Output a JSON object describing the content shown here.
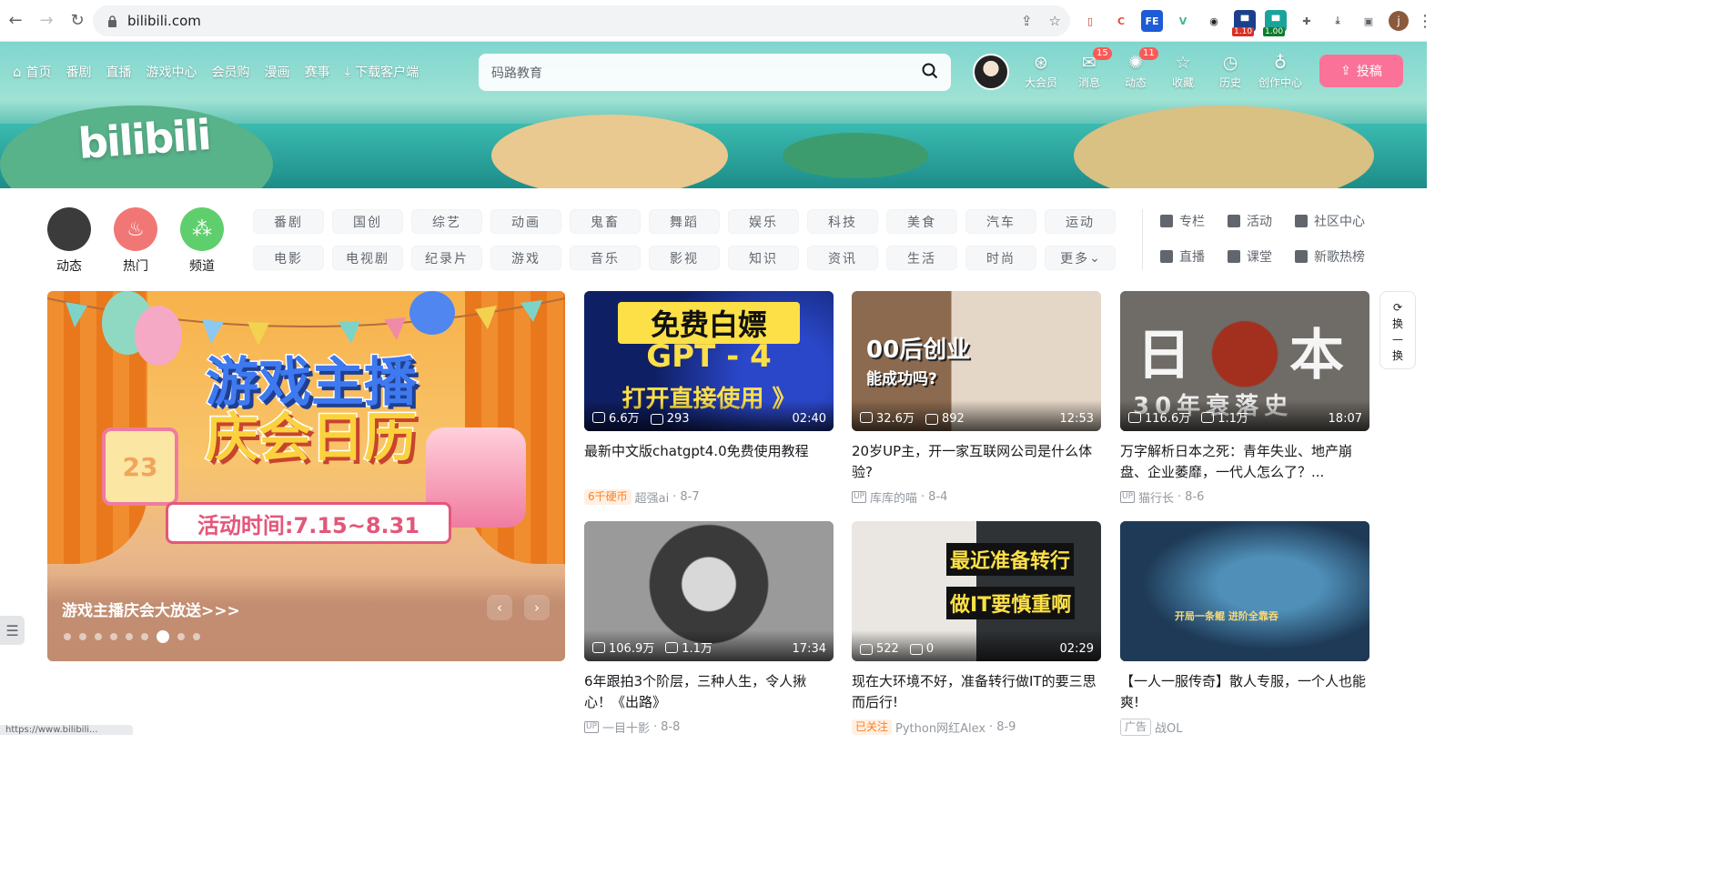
{
  "browser": {
    "url": "bilibili.com",
    "extensions": [
      {
        "name": "ext-book-icon",
        "bg": "#ffffff",
        "fg": "#c0392b",
        "glyph": "▯",
        "badge": ""
      },
      {
        "name": "ext-c-icon",
        "bg": "#ffffff",
        "fg": "#e84c3d",
        "glyph": "C",
        "badge": ""
      },
      {
        "name": "ext-fe-icon",
        "bg": "#1e5bd6",
        "fg": "#ffffff",
        "glyph": "FE",
        "badge": ""
      },
      {
        "name": "ext-vue-icon",
        "bg": "#ffffff",
        "fg": "#41b883",
        "glyph": "V",
        "badge": ""
      },
      {
        "name": "ext-mask-icon",
        "bg": "#ffffff",
        "fg": "#222222",
        "glyph": "◉",
        "badge": ""
      },
      {
        "name": "ext-red-icon",
        "bg": "#1c3f8c",
        "fg": "#ffffff",
        "glyph": "▀",
        "badge": "1.10",
        "badge_bg": "#d93025"
      },
      {
        "name": "ext-green-icon",
        "bg": "#1aa39a",
        "fg": "#ffffff",
        "glyph": "▀",
        "badge": "1.00",
        "badge_bg": "#0f7b2c"
      },
      {
        "name": "ext-puzzle-icon",
        "bg": "#ffffff",
        "fg": "#5f6368",
        "glyph": "✚",
        "badge": ""
      },
      {
        "name": "download-icon",
        "bg": "#ffffff",
        "fg": "#5f6368",
        "glyph": "⤓",
        "badge": ""
      },
      {
        "name": "sidebar-icon",
        "bg": "#ffffff",
        "fg": "#5f6368",
        "glyph": "▣",
        "badge": ""
      }
    ],
    "profile_initial": "j",
    "status_url": "https://www.bilibili..."
  },
  "header": {
    "nav": [
      {
        "name": "nav-home",
        "label": "首页",
        "icon": true
      },
      {
        "name": "nav-bangumi",
        "label": "番剧"
      },
      {
        "name": "nav-live",
        "label": "直播"
      },
      {
        "name": "nav-game-center",
        "label": "游戏中心"
      },
      {
        "name": "nav-vip-shop",
        "label": "会员购"
      },
      {
        "name": "nav-manga",
        "label": "漫画"
      },
      {
        "name": "nav-match",
        "label": "赛事"
      },
      {
        "name": "nav-download-client",
        "label": "下载客户端",
        "icon": true
      }
    ],
    "search_placeholder": "码路教育",
    "logo": "bilibili",
    "right": [
      {
        "name": "vip-entry",
        "label": "大会员",
        "glyph": "⊛",
        "badge": ""
      },
      {
        "name": "message-entry",
        "label": "消息",
        "glyph": "✉",
        "badge": "15"
      },
      {
        "name": "dynamic-entry",
        "label": "动态",
        "glyph": "✺",
        "badge": "11"
      },
      {
        "name": "favorites-entry",
        "label": "收藏",
        "glyph": "☆",
        "badge": ""
      },
      {
        "name": "history-entry",
        "label": "历史",
        "glyph": "◷",
        "badge": ""
      },
      {
        "name": "creator-center-entry",
        "label": "创作中心",
        "glyph": "♁",
        "badge": ""
      }
    ],
    "upload_label": "投稿"
  },
  "channels": {
    "icons": [
      {
        "name": "channel-dynamic",
        "label": "动态",
        "color": "#3b3b3b"
      },
      {
        "name": "channel-hot",
        "label": "热门",
        "color": "#f07775"
      },
      {
        "name": "channel-channels",
        "label": "频道",
        "color": "#5ecf6c"
      }
    ],
    "tags": [
      "番剧",
      "国创",
      "综艺",
      "动画",
      "鬼畜",
      "舞蹈",
      "娱乐",
      "科技",
      "美食",
      "汽车",
      "运动",
      "电影",
      "电视剧",
      "纪录片",
      "游戏",
      "音乐",
      "影视",
      "知识",
      "资讯",
      "生活",
      "时尚",
      "更多"
    ],
    "extra": [
      {
        "name": "column-link",
        "label": "专栏"
      },
      {
        "name": "activity-link",
        "label": "活动"
      },
      {
        "name": "community-link",
        "label": "社区中心"
      },
      {
        "name": "live-link",
        "label": "直播"
      },
      {
        "name": "classroom-link",
        "label": "课堂"
      },
      {
        "name": "new-songs-link",
        "label": "新歌热榜"
      }
    ]
  },
  "carousel": {
    "headline_line1": "游戏主播",
    "headline_line2": "庆会日历",
    "date_text": "活动时间:7.15~8.31",
    "calendar_day": "23",
    "caption": "游戏主播庆会大放送>>>",
    "dot_count": 9,
    "active_dot": 6
  },
  "videos": [
    {
      "title": "最新中文版chatgpt4.0免费使用教程",
      "views": "6.6万",
      "danmaku": "293",
      "duration": "02:40",
      "tag": "6千硬币",
      "tag_style": "orange",
      "author": "超强ai",
      "date": "8-7",
      "thumb_text": [
        "免费白嫖",
        "GPT - 4",
        "打开直接使用 》"
      ],
      "thumb_bg": "#0f1f63"
    },
    {
      "title": "20岁UP主，开一家互联网公司是什么体验?",
      "views": "32.6万",
      "danmaku": "892",
      "duration": "12:53",
      "tag": "",
      "tag_style": "up",
      "author": "库库的喵",
      "date": "8-4",
      "thumb_text": [
        "00后创业",
        "能成功吗?"
      ],
      "thumb_bg": "#d8c3a8"
    },
    {
      "title": "万字解析日本之死：青年失业、地产崩盘、企业萎靡，一代人怎么了？...",
      "views": "116.6万",
      "danmaku": "1.1万",
      "duration": "18:07",
      "tag": "",
      "tag_style": "up",
      "author": "猫行长",
      "date": "8-6",
      "thumb_text": [
        "日",
        "本",
        "30年衰落史"
      ],
      "thumb_bg": "#6f6b66"
    },
    {
      "title": "6年跟拍3个阶层，三种人生，令人揪心！《出路》",
      "views": "106.9万",
      "danmaku": "1.1万",
      "duration": "17:34",
      "tag": "",
      "tag_style": "up",
      "author": "一目十影",
      "date": "8-8",
      "thumb_text": [],
      "thumb_bg": "#8a8a8a"
    },
    {
      "title": "现在大环境不好，准备转行做IT的要三思而后行!",
      "views": "522",
      "danmaku": "0",
      "duration": "02:29",
      "tag": "已关注",
      "tag_style": "orange",
      "author": "Python网红Alex",
      "date": "8-9",
      "thumb_text": [
        "最近准备转行",
        "做IT要慎重啊"
      ],
      "thumb_bg": "#cfd3cf"
    },
    {
      "title": "【一人一服传奇】散人专服，一个人也能爽!",
      "views": "",
      "danmaku": "",
      "duration": "",
      "tag": "广告",
      "tag_style": "ad",
      "author": "战OL",
      "date": "",
      "thumb_text": [
        "开局一条鲲 进阶全靠吞"
      ],
      "thumb_bg": "#1e3a56"
    }
  ],
  "refresh": {
    "label_top": "换",
    "label_bottom": "换"
  }
}
